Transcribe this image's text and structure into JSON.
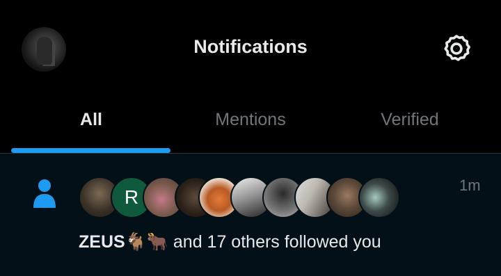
{
  "header": {
    "title": "Notifications",
    "avatar_icon": "profile-avatar",
    "settings_icon": "gear-icon"
  },
  "tabs": [
    {
      "label": "All",
      "active": true
    },
    {
      "label": "Mentions",
      "active": false
    },
    {
      "label": "Verified",
      "active": false
    }
  ],
  "notification": {
    "type_icon": "person-icon",
    "timestamp": "1m",
    "follower_name": "ZEUS",
    "follower_emojis": "🐐🐂",
    "message_rest": " and 17 others followed you",
    "avatars": [
      {
        "kind": "photo",
        "letter": ""
      },
      {
        "kind": "letter",
        "letter": "R"
      },
      {
        "kind": "photo",
        "letter": ""
      },
      {
        "kind": "photo",
        "letter": ""
      },
      {
        "kind": "photo",
        "letter": ""
      },
      {
        "kind": "photo",
        "letter": ""
      },
      {
        "kind": "photo",
        "letter": ""
      },
      {
        "kind": "photo",
        "letter": ""
      },
      {
        "kind": "photo",
        "letter": ""
      },
      {
        "kind": "photo",
        "letter": ""
      }
    ]
  },
  "colors": {
    "background": "#000000",
    "notification_bg": "#031017",
    "accent": "#1d9bf0",
    "text_primary": "#e7e9ea",
    "text_secondary": "#71767b"
  }
}
